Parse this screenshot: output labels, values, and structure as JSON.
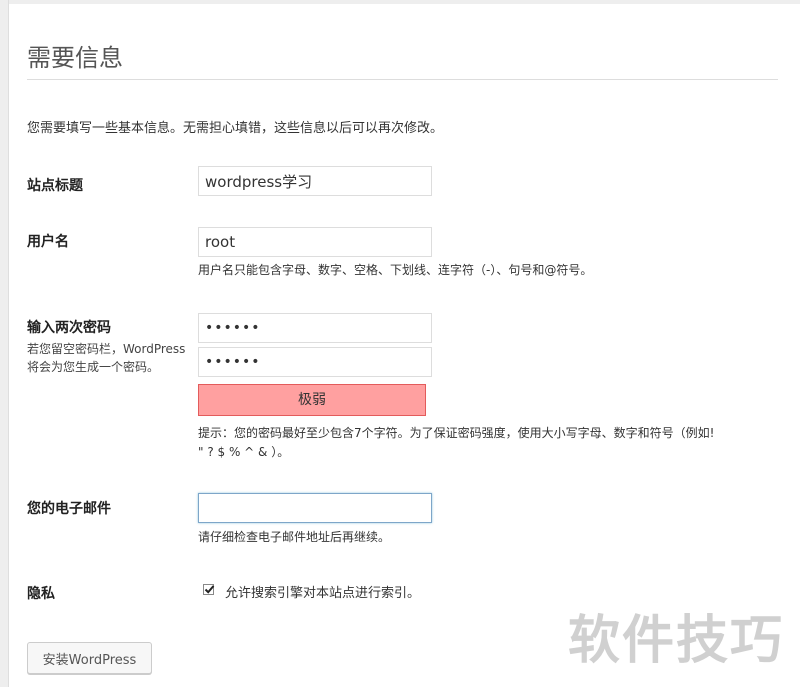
{
  "page": {
    "title": "需要信息",
    "intro": "您需要填写一些基本信息。无需担心填错，这些信息以后可以再次修改。"
  },
  "site_title": {
    "label": "站点标题",
    "value": "wordpress学习"
  },
  "username": {
    "label": "用户名",
    "value": "root",
    "hint": "用户名只能包含字母、数字、空格、下划线、连字符（-）、句号和@符号。"
  },
  "password": {
    "label": "输入两次密码",
    "sub_label": "若您留空密码栏，WordPress将会为您生成一个密码。",
    "value1": "••••••",
    "value2": "••••••",
    "strength": "极弱",
    "strength_color": "#ffa0a0",
    "hint_line1": "提示：您的密码最好至少包含7个字符。为了保证密码强度，使用大小写字母、数字和符号（例如!",
    "hint_line2": "\" ? $ % ^ & ）。"
  },
  "email": {
    "label": "您的电子邮件",
    "value": "",
    "hint": "请仔细检查电子邮件地址后再继续。"
  },
  "privacy": {
    "label": "隐私",
    "checkbox_label": "允许搜索引擎对本站点进行索引。",
    "checked": true
  },
  "install_button": "安装WordPress",
  "watermark": "软件技巧"
}
